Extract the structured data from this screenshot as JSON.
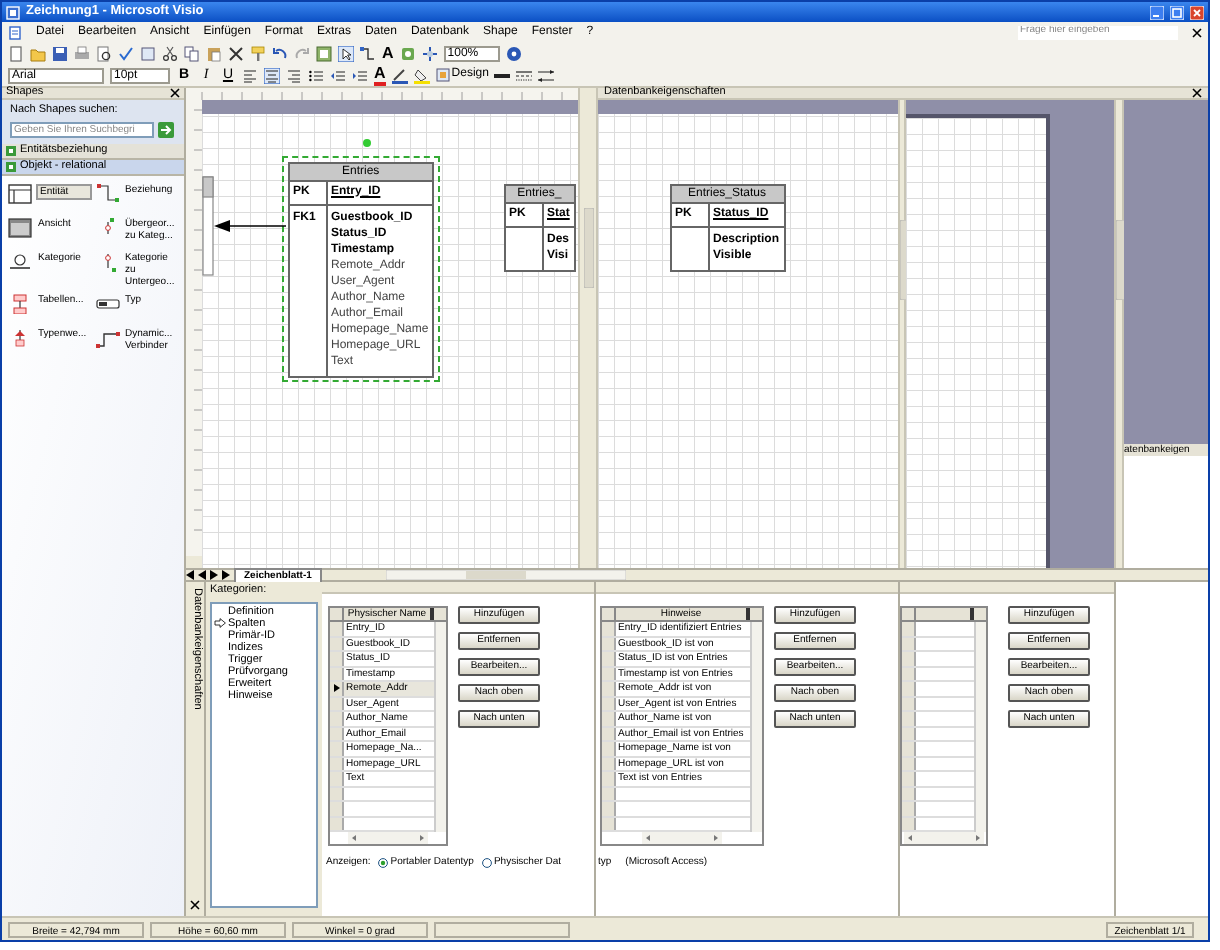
{
  "window": {
    "title": "Zeichnung1 - Microsoft Visio"
  },
  "menu": [
    "Datei",
    "Bearbeiten",
    "Ansicht",
    "Einfügen",
    "Format",
    "Extras",
    "Daten",
    "Datenbank",
    "Shape",
    "Fenster",
    "?"
  ],
  "help_box": {
    "placeholder": "Frage hier eingeben"
  },
  "toolbar": {
    "text_tool": "A",
    "zoom": "100%",
    "font": "Arial",
    "font_size": "10pt",
    "format_buttons": [
      {
        "label": "B",
        "kind": "bold"
      },
      {
        "label": "I",
        "kind": "italic"
      },
      {
        "label": "U",
        "kind": "underline"
      }
    ],
    "align": [
      {
        "kind": "left",
        "selected": false
      },
      {
        "kind": "center",
        "selected": true
      },
      {
        "kind": "right",
        "selected": false
      }
    ],
    "font_color": "A",
    "design": "Design"
  },
  "shapes_panel": {
    "title": "Shapes",
    "search_label": "Nach Shapes suchen:",
    "search": {
      "placeholder": "Geben Sie Ihren Suchbegri"
    },
    "stencils": [
      {
        "label": "Entitätsbeziehung",
        "selected": false
      },
      {
        "label": "Objekt - relational",
        "selected": true
      }
    ],
    "shapes": [
      {
        "label": "Entität",
        "kind": "entity",
        "selected": true
      },
      {
        "label": "Beziehung",
        "kind": "relation",
        "selected": false
      },
      {
        "label": "Ansicht",
        "kind": "view",
        "selected": false
      },
      {
        "label": "Übergeor... zu Kateg...",
        "kind": "parent",
        "selected": false
      },
      {
        "label": "Kategorie",
        "kind": "category",
        "selected": false
      },
      {
        "label": "Kategorie zu Untergeo...",
        "kind": "child",
        "selected": false
      },
      {
        "label": "Tabellen...",
        "kind": "table",
        "selected": false
      },
      {
        "label": "Typ",
        "kind": "type",
        "selected": false
      },
      {
        "label": "Typenwe...",
        "kind": "typeref",
        "selected": false
      },
      {
        "label": "Dynamic... Verbinder",
        "kind": "connector",
        "selected": false
      }
    ]
  },
  "canvas": {
    "pane_title": "Datenbankeigenschaften",
    "side_title": "atenbankeigen",
    "tables": [
      {
        "title": "Entries",
        "selected": true,
        "pk_label": "PK",
        "pk_field": "Entry_ID",
        "fk_label": "FK1",
        "fields": [
          {
            "name": "Guestbook_ID",
            "bold": true
          },
          {
            "name": "Status_ID",
            "bold": true
          },
          {
            "name": "Timestamp",
            "bold": true
          },
          {
            "name": "Remote_Addr",
            "bold": false
          },
          {
            "name": "User_Agent",
            "bold": false
          },
          {
            "name": "Author_Name",
            "bold": false
          },
          {
            "name": "Author_Email",
            "bold": false
          },
          {
            "name": "Homepage_Name",
            "bold": false
          },
          {
            "name": "Homepage_URL",
            "bold": false
          },
          {
            "name": "Text",
            "bold": false
          }
        ]
      },
      {
        "title": "Entries_",
        "selected": false,
        "pk_label": "PK",
        "pk_field": "Stat",
        "fields": [
          {
            "name": "Des",
            "bold": true
          },
          {
            "name": "Visi",
            "bold": true
          }
        ]
      },
      {
        "title": "Entries_Status",
        "selected": false,
        "pk_label": "PK",
        "pk_field": "Status_ID",
        "fields": [
          {
            "name": "Description",
            "bold": true
          },
          {
            "name": "Visible",
            "bold": true
          }
        ]
      }
    ]
  },
  "page_tab": {
    "label": "Zeichenblatt-1",
    "selected": true
  },
  "db_properties": {
    "title": "Datenbankeigenschaften",
    "categories_label": "Kategorien:",
    "categories": [
      {
        "label": "Definition",
        "selected": false
      },
      {
        "label": "Spalten",
        "selected": true
      },
      {
        "label": "Primär-ID",
        "selected": false
      },
      {
        "label": "Indizes",
        "selected": false
      },
      {
        "label": "Trigger",
        "selected": false
      },
      {
        "label": "Prüfvorgang",
        "selected": false
      },
      {
        "label": "Erweitert",
        "selected": false
      },
      {
        "label": "Hinweise",
        "selected": false
      }
    ],
    "columns_grid": {
      "header": "Physischer Name",
      "rows": [
        {
          "name": "Entry_ID",
          "selected": false
        },
        {
          "name": "Guestbook_ID",
          "selected": false
        },
        {
          "name": "Status_ID",
          "selected": false
        },
        {
          "name": "Timestamp",
          "selected": false
        },
        {
          "name": "Remote_Addr",
          "selected": true
        },
        {
          "name": "User_Agent",
          "selected": false
        },
        {
          "name": "Author_Name",
          "selected": false
        },
        {
          "name": "Author_Email",
          "selected": false
        },
        {
          "name": "Homepage_Na...",
          "selected": false
        },
        {
          "name": "Homepage_URL",
          "selected": false
        },
        {
          "name": "Text",
          "selected": false
        }
      ]
    },
    "buttons": [
      "Hinzufügen",
      "Entfernen",
      "Bearbeiten...",
      "Nach oben",
      "Nach unten"
    ],
    "show_label": "Anzeigen:",
    "type_options": [
      {
        "label": "Portabler Datentyp",
        "selected": true
      },
      {
        "label": "Physischer Dat",
        "selected": false
      }
    ],
    "notes_panel": {
      "overflow_text": "typ",
      "dbms": "(Microsoft Access)",
      "grid": {
        "header": "Hinweise",
        "rows": [
          {
            "name": "Entry_ID identifiziert Entries",
            "selected": false
          },
          {
            "name": "Guestbook_ID ist von",
            "selected": false
          },
          {
            "name": "Status_ID ist von Entries",
            "selected": false
          },
          {
            "name": "Timestamp ist von Entries",
            "selected": false
          },
          {
            "name": "Remote_Addr ist von",
            "selected": false
          },
          {
            "name": "User_Agent ist von Entries",
            "selected": false
          },
          {
            "name": "Author_Name ist von",
            "selected": false
          },
          {
            "name": "Author_Email ist von Entries",
            "selected": false
          },
          {
            "name": "Homepage_Name ist von",
            "selected": false
          },
          {
            "name": "Homepage_URL ist von",
            "selected": false
          },
          {
            "name": "Text ist von Entries",
            "selected": false
          }
        ]
      },
      "buttons": [
        "Hinzufügen",
        "Entfernen",
        "Bearbeiten...",
        "Nach oben",
        "Nach unten"
      ]
    },
    "third_panel": {
      "buttons": [
        "Hinzufügen",
        "Entfernen",
        "Bearbeiten...",
        "Nach oben",
        "Nach unten"
      ]
    }
  },
  "status_bar": {
    "cells": [
      "Breite = 42,794 mm",
      "Höhe = 60,60 mm",
      "Winkel = 0 grad"
    ],
    "page": "Zeichenblatt 1/1"
  }
}
